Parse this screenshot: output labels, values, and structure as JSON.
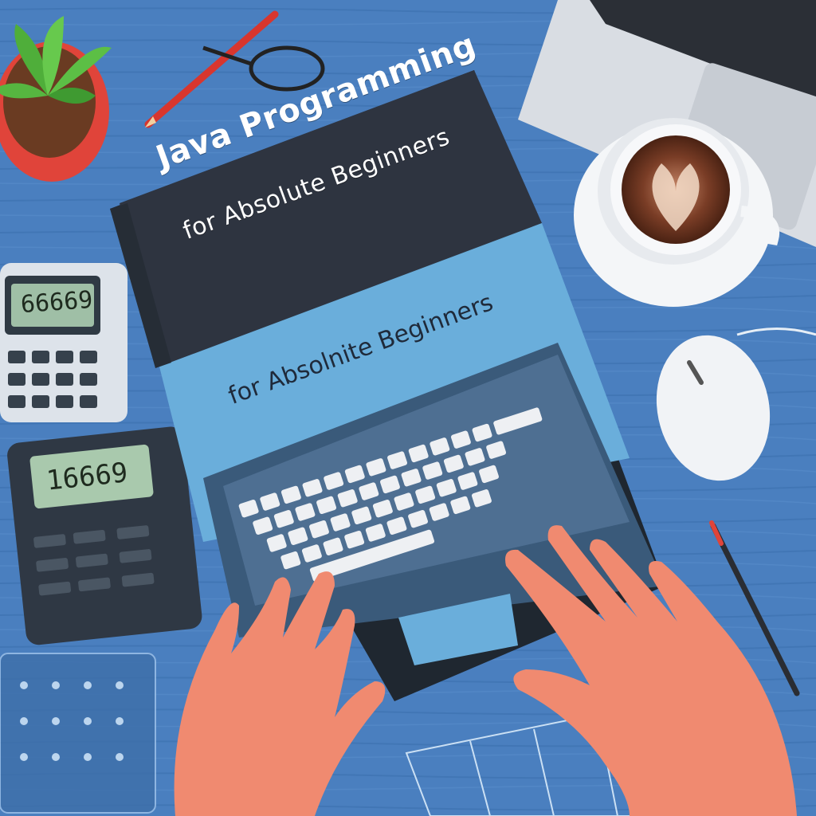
{
  "book": {
    "title_line1": "Java Programming",
    "title_line2": "for Absolute Beginners",
    "cover_subtitle": "for Absolnite Beginners"
  },
  "calculators": {
    "top_display": "66669",
    "bottom_display": "16669"
  },
  "icons": {
    "plant": "potted-plant-icon",
    "pencil": "pencil-icon",
    "glasses": "eyeglasses-icon",
    "laptop": "laptop-icon",
    "coffee": "coffee-cup-icon",
    "mouse": "computer-mouse-icon",
    "pen": "pen-icon"
  },
  "colors": {
    "desk": "#4a7fbf",
    "cover_dark": "#2e3440",
    "cover_light": "#6aaedb",
    "keyboard": "#3a5a7a",
    "skin": "#f08a70"
  }
}
